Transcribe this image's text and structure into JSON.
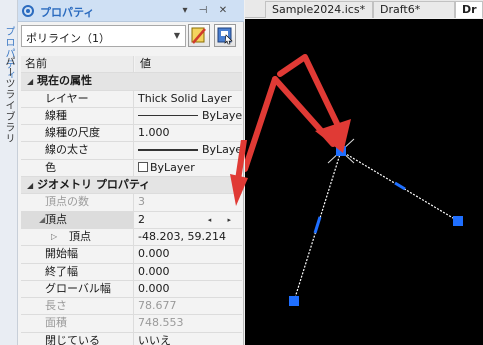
{
  "left_strip": {
    "tab1": "プロパティ",
    "tab2": "パーツライブラリ"
  },
  "panel": {
    "title": "プロパティ",
    "pin_glyph": "▾",
    "close_glyph": "✕",
    "autohide_glyph": "⊣",
    "selector": {
      "value": "ポリライン（1）"
    },
    "buttons": [
      {
        "icon": "clear-select-icon"
      },
      {
        "icon": "quick-select-icon"
      }
    ],
    "header": {
      "name": "名前",
      "value": "値"
    },
    "rows": [
      {
        "type": "cat",
        "label": "現在の属性",
        "tri": "◢"
      },
      {
        "type": "prop",
        "label": "レイヤー",
        "value": "Thick Solid Layer"
      },
      {
        "type": "prop",
        "label": "線種",
        "value": "ByLayer",
        "swatch": "thin"
      },
      {
        "type": "prop",
        "label": "線種の尺度",
        "value": "1.000"
      },
      {
        "type": "prop",
        "label": "線の太さ",
        "value": "ByLayer",
        "swatch": "thick"
      },
      {
        "type": "prop",
        "label": "色",
        "value": "ByLayer",
        "swatch": "color"
      },
      {
        "type": "cat",
        "label": "ジオメトリ プロパティ",
        "tri": "◢"
      },
      {
        "type": "gray",
        "label": "頂点の数",
        "value": "3"
      },
      {
        "type": "sel",
        "label": "頂点",
        "value": "2",
        "spin": "◂ ▸",
        "tri": "◢"
      },
      {
        "type": "sub",
        "label": "頂点",
        "value": "-48.203, 59.214",
        "tri": "▷"
      },
      {
        "type": "prop",
        "label": "開始幅",
        "value": "0.000"
      },
      {
        "type": "prop",
        "label": "終了幅",
        "value": "0.000"
      },
      {
        "type": "prop",
        "label": "グローバル幅",
        "value": "0.000"
      },
      {
        "type": "gray",
        "label": "長さ",
        "value": "78.677"
      },
      {
        "type": "gray",
        "label": "面積",
        "value": "748.553"
      },
      {
        "type": "prop",
        "label": "閉じている",
        "value": "いいえ"
      }
    ]
  },
  "tabs": [
    {
      "label": "Sample2024.ics*"
    },
    {
      "label": "Draft6*"
    },
    {
      "label": "Dr"
    }
  ],
  "colors": {
    "canvas_bg": "#000000",
    "polyline": "#ffffff",
    "grip": "#1f6fff",
    "arrow": "#e03a35",
    "accent": "#2b6bbf"
  }
}
